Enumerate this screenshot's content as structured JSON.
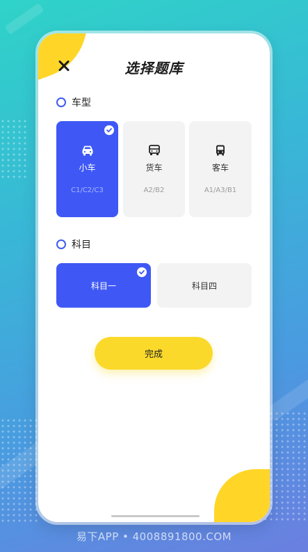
{
  "header": {
    "title": "选择题库",
    "close_icon": "close-icon"
  },
  "vehicle_section": {
    "label": "车型",
    "options": [
      {
        "name": "小车",
        "codes": "C1/C2/C3",
        "icon": "car-icon",
        "selected": true
      },
      {
        "name": "货车",
        "codes": "A2/B2",
        "icon": "truck-icon",
        "selected": false
      },
      {
        "name": "客车",
        "codes": "A1/A3/B1",
        "icon": "bus-icon",
        "selected": false
      }
    ]
  },
  "subject_section": {
    "label": "科目",
    "options": [
      {
        "name": "科目一",
        "selected": true
      },
      {
        "name": "科目四",
        "selected": false
      }
    ]
  },
  "done_button": "完成",
  "footer": "易下APP • 4008891800.COM",
  "colors": {
    "accent_blue": "#3f58f5",
    "accent_yellow": "#fbd92b",
    "card_bg": "#f3f3f3"
  }
}
